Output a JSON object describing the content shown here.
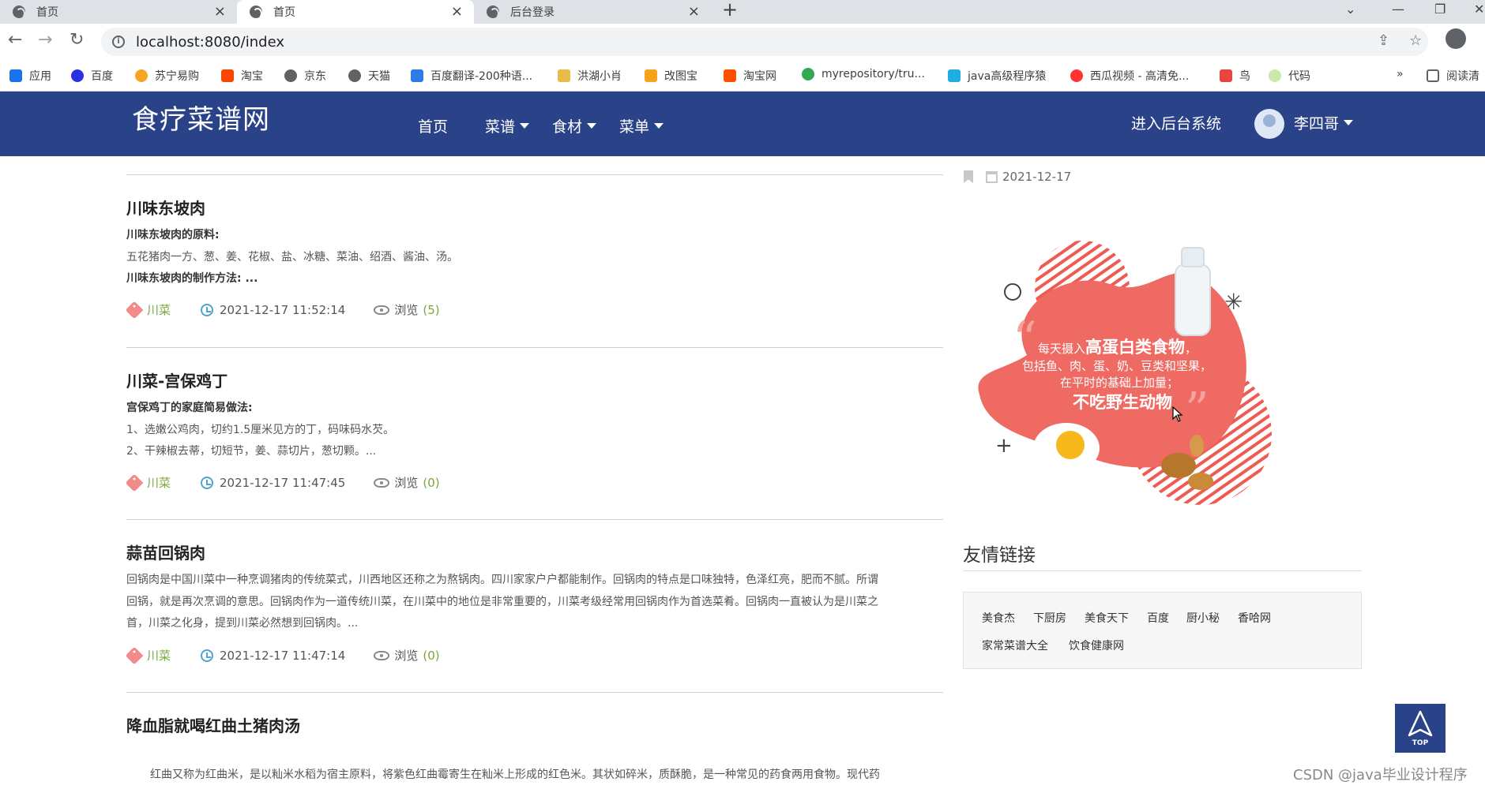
{
  "browser": {
    "tabs": [
      {
        "label": "首页",
        "active": false
      },
      {
        "label": "首页",
        "active": true
      },
      {
        "label": "后台登录",
        "active": false
      }
    ],
    "url": "localhost:8080/index",
    "bookmarks": [
      {
        "label": "应用",
        "icon": "apps-grid-icon"
      },
      {
        "label": "百度",
        "icon": "baidu-paw-icon"
      },
      {
        "label": "苏宁易购",
        "icon": "suning-icon"
      },
      {
        "label": "淘宝",
        "icon": "taobao-icon"
      },
      {
        "label": "京东",
        "icon": "globe-icon"
      },
      {
        "label": "天猫",
        "icon": "globe-icon"
      },
      {
        "label": "百度翻译-200种语...",
        "icon": "baidu-translate-icon"
      },
      {
        "label": "洪湖小肖",
        "icon": "hongshu-icon"
      },
      {
        "label": "改图宝",
        "icon": "gaitubao-icon"
      },
      {
        "label": "淘宝网",
        "icon": "taobao-icon"
      },
      {
        "label": "myrepository/tru...",
        "icon": "chrome-icon"
      },
      {
        "label": "java高级程序猿",
        "icon": "bilibili-icon"
      },
      {
        "label": "西瓜视频 - 高清免...",
        "icon": "xigua-icon"
      },
      {
        "label": "鸟",
        "icon": "bird-icon"
      },
      {
        "label": "代码",
        "icon": "code-icon"
      }
    ],
    "bookmarks_overflow": "»",
    "reading_list": "阅读清"
  },
  "site": {
    "logo": "食疗菜谱网",
    "nav": [
      {
        "label": "首页",
        "dropdown": false
      },
      {
        "label": "菜谱",
        "dropdown": true
      },
      {
        "label": "食材",
        "dropdown": true
      },
      {
        "label": "菜单",
        "dropdown": true
      }
    ],
    "admin_link": "进入后台系统",
    "username": "李四哥"
  },
  "posts": [
    {
      "title": "川味东坡肉",
      "lines": [
        {
          "text": "川味东坡肉的原料:",
          "bold": true
        },
        {
          "text": "五花猪肉一方、葱、姜、花椒、盐、冰糖、菜油、绍酒、酱油、汤。",
          "bold": false
        },
        {
          "text": "川味东坡肉的制作方法: ...",
          "bold": true
        }
      ],
      "tag": "川菜",
      "time": "2021-12-17 11:52:14",
      "views_label": "浏览",
      "views": "(5)"
    },
    {
      "title": "川菜-宫保鸡丁",
      "lines": [
        {
          "text": "宫保鸡丁的家庭简易做法:",
          "bold": true
        },
        {
          "text": "1、选嫩公鸡肉，切约1.5厘米见方的丁，码味码水芡。",
          "bold": false
        },
        {
          "text": "2、干辣椒去蒂，切短节，姜、蒜切片，葱切颗。...",
          "bold": false
        }
      ],
      "tag": "川菜",
      "time": "2021-12-17 11:47:45",
      "views_label": "浏览",
      "views": "(0)"
    },
    {
      "title": "蒜苗回锅肉",
      "lines": [
        {
          "text": "回锅肉是中国川菜中一种烹调猪肉的传统菜式，川西地区还称之为熬锅肉。四川家家户户都能制作。回锅肉的特点是口味独特，色泽红亮，肥而不腻。所谓",
          "bold": false
        },
        {
          "text": "回锅，就是再次烹调的意思。回锅肉作为一道传统川菜，在川菜中的地位是非常重要的，川菜考级经常用回锅肉作为首选菜肴。回锅肉一直被认为是川菜之",
          "bold": false
        },
        {
          "text": "首，川菜之化身，提到川菜必然想到回锅肉。...",
          "bold": false
        }
      ],
      "tag": "川菜",
      "time": "2021-12-17 11:47:14",
      "views_label": "浏览",
      "views": "(0)"
    },
    {
      "title": "降血脂就喝红曲土猪肉汤",
      "lines": [
        {
          "text": "红曲又称为红曲米，是以籼米水稻为宿主原料，将紫色红曲霉寄生在籼米上形成的红色米。其状如碎米，质酥脆，是一种常见的药食两用食物。现代药",
          "bold": false
        }
      ]
    }
  ],
  "sidebar": {
    "date": "2021-12-17",
    "promo": {
      "line1_prefix": "每天摄入",
      "line1_emph": "高蛋白类食物",
      "line1_suffix": "，",
      "line2": "包括鱼、肉、蛋、奶、豆类和坚果，",
      "line3": "在平时的基础上加量；",
      "line4": "不吃野生动物"
    },
    "friends_title": "友情链接",
    "friend_links": [
      "美食杰",
      "下厨房",
      "美食天下",
      "百度",
      "厨小秘",
      "香哈网",
      "家常菜谱大全",
      "饮食健康网"
    ]
  },
  "back_to_top": "TOP",
  "watermark": "CSDN @java毕业设计程序"
}
